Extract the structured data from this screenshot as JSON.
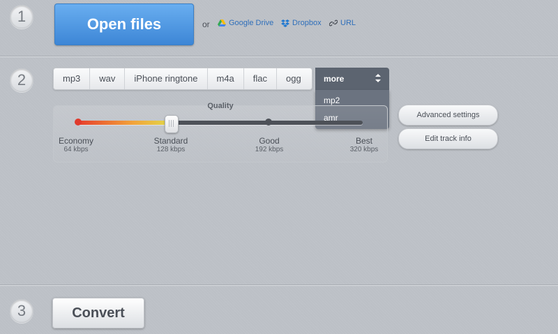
{
  "steps": {
    "one": "1",
    "two": "2",
    "three": "3"
  },
  "upload": {
    "open_label": "Open files",
    "or_label": "or",
    "sources": [
      {
        "label": "Google Drive",
        "icon": "google-drive-icon"
      },
      {
        "label": "Dropbox",
        "icon": "dropbox-icon"
      },
      {
        "label": "URL",
        "icon": "link-icon"
      }
    ]
  },
  "formats": {
    "tabs": [
      "mp3",
      "wav",
      "iPhone ringtone",
      "m4a",
      "flac",
      "ogg"
    ],
    "more_label": "more",
    "more_options": [
      "mp2",
      "amr"
    ]
  },
  "quality": {
    "title": "Quality",
    "selected_level": 1,
    "levels": [
      {
        "label": "Economy",
        "rate": "64 kbps"
      },
      {
        "label": "Standard",
        "rate": "128 kbps"
      },
      {
        "label": "Good",
        "rate": "192 kbps"
      },
      {
        "label": "Best",
        "rate": "320 kbps"
      }
    ]
  },
  "settings": {
    "advanced_label": "Advanced settings",
    "edit_track_label": "Edit track info"
  },
  "convert": {
    "label": "Convert"
  },
  "colors": {
    "primary_button": "#4a93e0",
    "more_tab": "#5c6470",
    "slider_low": "#e63b2b",
    "slider_high": "#e2d84a"
  }
}
